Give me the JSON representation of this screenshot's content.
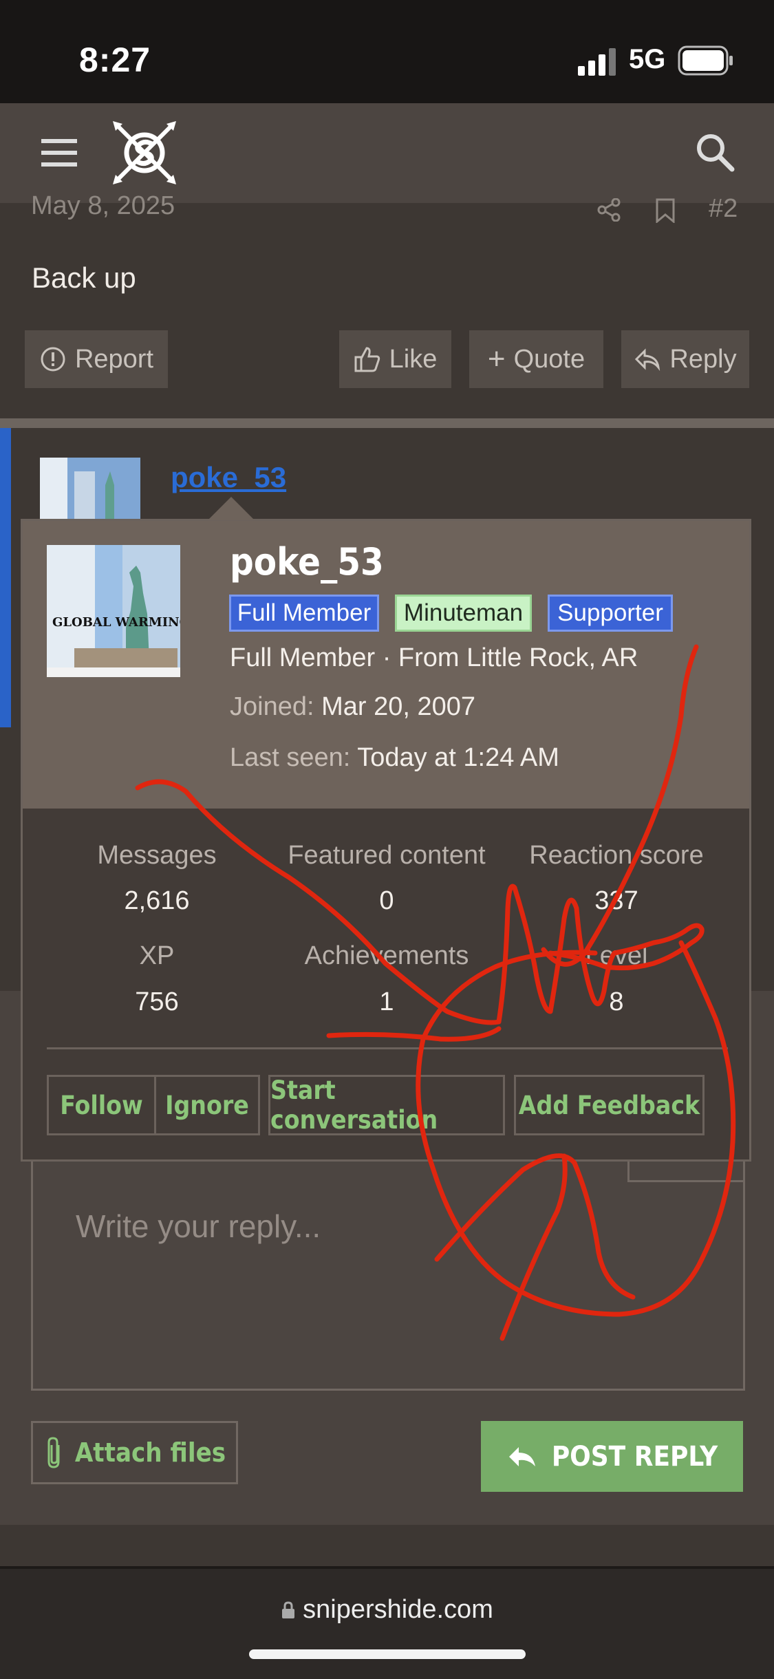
{
  "status_bar": {
    "time": "8:27",
    "network": "5G"
  },
  "header": {
    "menu_icon": "hamburger-menu-icon",
    "logo_icon": "sniper-logo-icon",
    "search_icon": "search-icon"
  },
  "post": {
    "date": "May 8, 2025",
    "number": "#2",
    "body": "Back up",
    "actions": {
      "report": "Report",
      "like": "Like",
      "quote": "Quote",
      "reply": "Reply"
    }
  },
  "post2": {
    "username": "poke_53"
  },
  "popup": {
    "username": "poke_53",
    "avatar_text": "GLOBAL WARMING",
    "badges": [
      "Full Member",
      "Minuteman",
      "Supporter"
    ],
    "title_line": "Full Member · From Little Rock, AR",
    "joined_label": "Joined:",
    "joined_value": "Mar 20, 2007",
    "last_seen_label": "Last seen:",
    "last_seen_value": "Today at 1:24 AM",
    "stats": [
      {
        "label": "Messages",
        "value": "2,616"
      },
      {
        "label": "Featured content",
        "value": "0"
      },
      {
        "label": "Reaction score",
        "value": "337"
      },
      {
        "label": "XP",
        "value": "756"
      },
      {
        "label": "Achievements",
        "value": "1"
      },
      {
        "label": "Level",
        "value": "8"
      }
    ],
    "buttons": {
      "follow": "Follow",
      "ignore": "Ignore",
      "start": "Start conversation",
      "feedback": "Add Feedback"
    }
  },
  "reply": {
    "placeholder": "Write your reply...",
    "attach": "Attach files",
    "post_reply": "POST REPLY"
  },
  "browser": {
    "url": "snipershide.com"
  },
  "colors": {
    "accent_green": "#77ad68",
    "link_blue": "#2a6cd6",
    "badge_blue": "#3b63d6",
    "badge_green": "#c9f2c5",
    "scribble": "#e0260f"
  }
}
